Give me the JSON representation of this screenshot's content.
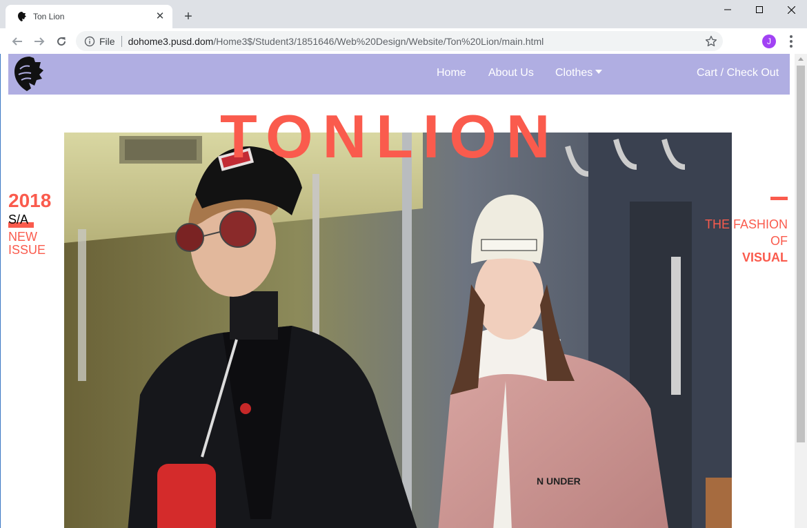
{
  "browser": {
    "tab_title": "Ton Lion",
    "file_label": "File",
    "url_host": "dohome3.pusd.dom",
    "url_path": "/Home3$/Student3/1851646/Web%20Design/Website/Ton%20Lion/main.html",
    "profile_initial": "J",
    "profile_color": "#a142f4"
  },
  "site": {
    "logo_text": "Ton Lion",
    "nav": {
      "home": "Home",
      "about": "About Us",
      "clothes": "Clothes",
      "cart": "Cart / Check Out"
    },
    "nav_color": "#b0aee2",
    "accent_color": "#fa5b4d"
  },
  "hero": {
    "title": "TONLION",
    "left": {
      "year": "2018",
      "season": "S/A",
      "issue_line1": "NEW",
      "issue_line2": "ISSUE"
    },
    "right": {
      "line1": "THE FASHION",
      "line2": "OF",
      "line3": "VISUAL"
    },
    "photo_description_icons": [
      "subway-train-interior",
      "couple-in-winter-jackets"
    ]
  }
}
